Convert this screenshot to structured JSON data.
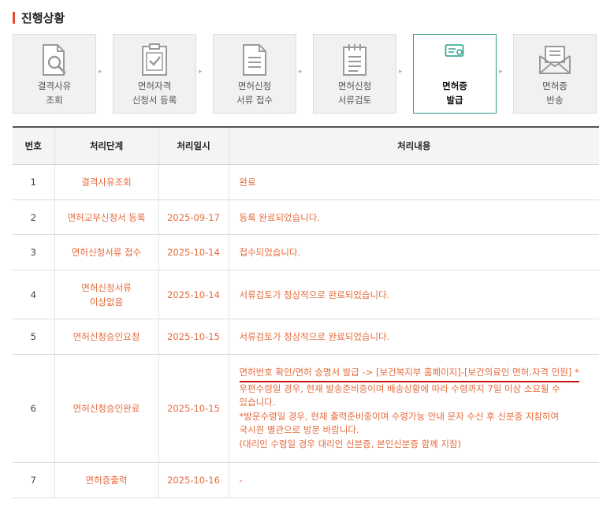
{
  "title": "진행상황",
  "steps": [
    {
      "line1": "결격사유",
      "line2": "조회",
      "icon": "search-document-icon",
      "active": false
    },
    {
      "line1": "면허자격",
      "line2": "신청서 등록",
      "icon": "clipboard-check-icon",
      "active": false
    },
    {
      "line1": "면허신청",
      "line2": "서류 접수",
      "icon": "document-icon",
      "active": false
    },
    {
      "line1": "면허신청",
      "line2": "서류검토",
      "icon": "notepad-icon",
      "active": false
    },
    {
      "line1": "면허증",
      "line2": "발급",
      "icon": "license-card-icon",
      "active": true
    },
    {
      "line1": "면허증",
      "line2": "반송",
      "icon": "envelope-icon",
      "active": false
    }
  ],
  "table": {
    "headers": [
      "번호",
      "처리단계",
      "처리일시",
      "처리내용"
    ],
    "rows": [
      {
        "no": "1",
        "stage": "결격사유조회",
        "date": "",
        "content": "완료"
      },
      {
        "no": "2",
        "stage": "면허교부신청서 등록",
        "date": "2025-09-17",
        "content": "등록 완료되었습니다."
      },
      {
        "no": "3",
        "stage": "면허신청서류 접수",
        "date": "2025-10-14",
        "content": "접수되었습니다."
      },
      {
        "no": "4",
        "stage_line1": "면허신청서류",
        "stage_line2": "이상없음",
        "date": "2025-10-14",
        "content": "서류검토가 정상적으로 완료되었습니다."
      },
      {
        "no": "5",
        "stage": "면허신청승인요청",
        "date": "2025-10-15",
        "content": "서류검토가 정상적으로 완료되었습니다."
      },
      {
        "no": "6",
        "stage": "면허신청승인완료",
        "date": "2025-10-15",
        "link_text": "면허번호 확인/면허 승명서 발급 -> [보건복지부 홈페이지]-[보건의료인 면허.자격 민원] *",
        "lines": [
          "우편수령일 경우, 현재 발송준비중이며 배송상황에 따라 수령까지 7일 이상 소요될 수",
          "있습니다.",
          "*방문수령일 경우, 현재 출력준비중이며 수령가능 안내 문자 수신 후 신분증 지참하여",
          "국시원 별관으로 방문 바랍니다.",
          "(대리인 수령일 경우 대리인 신분증, 본인신분증 함께 지참)"
        ]
      },
      {
        "no": "7",
        "stage": "면허증출력",
        "date": "2025-10-16",
        "content": "-"
      }
    ]
  },
  "colors": {
    "accent": "#e56a3c",
    "active_border": "#2a9c8a",
    "title_bar": "#e0492b",
    "underline": "#cc1111"
  }
}
